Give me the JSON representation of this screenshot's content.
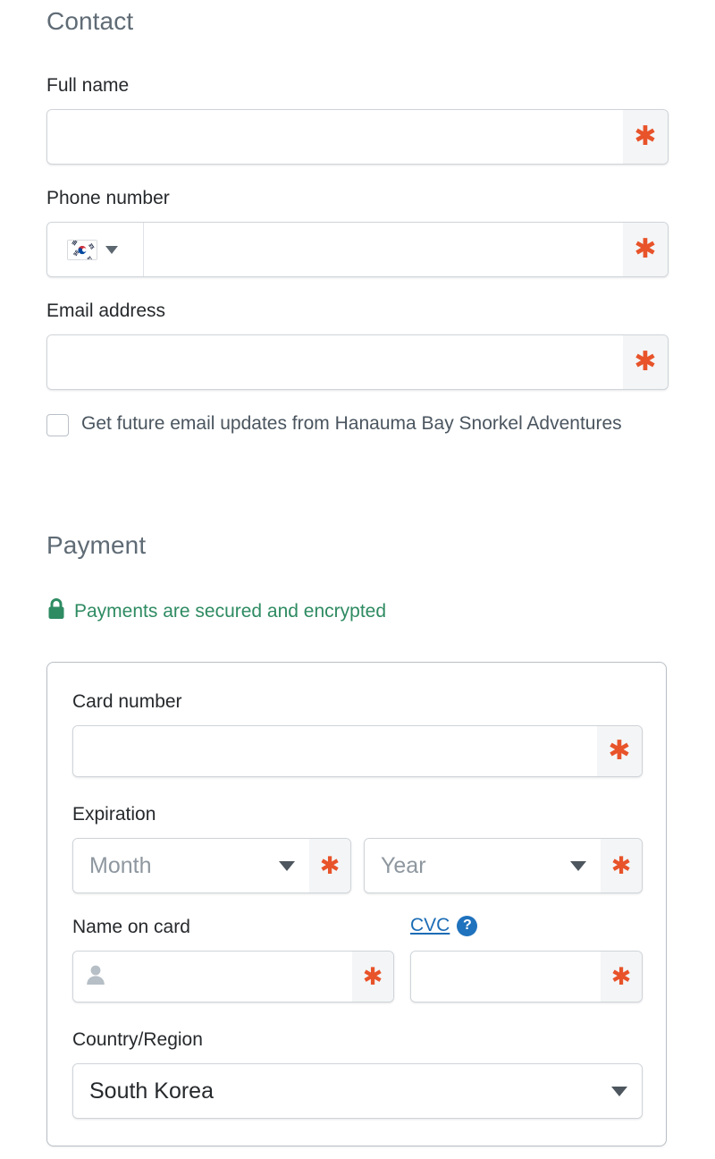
{
  "contact": {
    "heading": "Contact",
    "full_name": {
      "label": "Full name",
      "value": "",
      "required_mark": "✱"
    },
    "phone": {
      "label": "Phone number",
      "value": "",
      "required_mark": "✱",
      "country_flag_icon": "south-korea-flag"
    },
    "email": {
      "label": "Email address",
      "value": "",
      "required_mark": "✱"
    },
    "marketing_optin": {
      "label": "Get future email updates from Hanauma Bay Snorkel Adventures",
      "checked": false
    }
  },
  "payment": {
    "heading": "Payment",
    "secure_note": {
      "text": "Payments are secured and encrypted",
      "icon": "lock-icon"
    },
    "card_number": {
      "label": "Card number",
      "value": "",
      "required_mark": "✱"
    },
    "expiration": {
      "label": "Expiration",
      "month": {
        "value": "Month",
        "required_mark": "✱"
      },
      "year": {
        "value": "Year",
        "required_mark": "✱"
      }
    },
    "name_on_card": {
      "label": "Name on card",
      "value": "",
      "required_mark": "✱",
      "icon": "person-icon"
    },
    "cvc": {
      "label": "CVC",
      "value": "",
      "required_mark": "✱",
      "help_glyph": "?"
    },
    "country": {
      "label": "Country/Region",
      "value": "South Korea"
    }
  },
  "colors": {
    "required_asterisk": "#e8532a",
    "secure_green": "#2e8b62",
    "link_blue": "#1b6cb5",
    "heading_gray": "#5f6b75",
    "label_dark": "#26292c",
    "placeholder_gray": "#8e979f",
    "field_border": "#cfd4d9",
    "card_border": "#b8bfc6"
  }
}
